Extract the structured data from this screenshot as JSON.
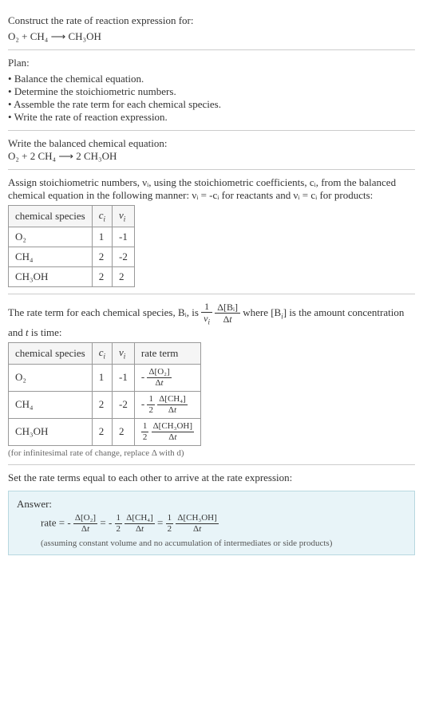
{
  "header": {
    "prompt": "Construct the rate of reaction expression for:",
    "unbalanced": "O₂ + CH₄  ⟶  CH₃OH"
  },
  "plan": {
    "label": "Plan:",
    "items": [
      "Balance the chemical equation.",
      "Determine the stoichiometric numbers.",
      "Assemble the rate term for each chemical species.",
      "Write the rate of reaction expression."
    ]
  },
  "balanced": {
    "label": "Write the balanced chemical equation:",
    "eq": "O₂ + 2 CH₄  ⟶  2 CH₃OH"
  },
  "stoich_intro": "Assign stoichiometric numbers, νᵢ, using the stoichiometric coefficients, cᵢ, from the balanced chemical equation in the following manner: νᵢ = -cᵢ for reactants and νᵢ = cᵢ for products:",
  "stoich_table": {
    "headers": [
      "chemical species",
      "cᵢ",
      "νᵢ"
    ],
    "rows": [
      {
        "species": "O₂",
        "c": "1",
        "v": "-1"
      },
      {
        "species": "CH₄",
        "c": "2",
        "v": "-2"
      },
      {
        "species": "CH₃OH",
        "c": "2",
        "v": "2"
      }
    ]
  },
  "rate_intro_pre": "The rate term for each chemical species, Bᵢ, is ",
  "rate_intro_frac_top1": "1",
  "rate_intro_frac_bot1": "νᵢ",
  "rate_intro_frac_top2": "Δ[Bᵢ]",
  "rate_intro_frac_bot2": "Δt",
  "rate_intro_post": " where [Bᵢ] is the amount concentration and t is time:",
  "rate_table": {
    "headers": [
      "chemical species",
      "cᵢ",
      "νᵢ",
      "rate term"
    ],
    "rows": [
      {
        "species": "O₂",
        "c": "1",
        "v": "-1",
        "coef": "",
        "neg": "-",
        "top": "Δ[O₂]",
        "bot": "Δt"
      },
      {
        "species": "CH₄",
        "c": "2",
        "v": "-2",
        "coef": "½",
        "neg": "-",
        "top": "Δ[CH₄]",
        "bot": "Δt",
        "coefTop": "1",
        "coefBot": "2"
      },
      {
        "species": "CH₃OH",
        "c": "2",
        "v": "2",
        "coef": "½",
        "neg": "",
        "top": "Δ[CH₃OH]",
        "bot": "Δt",
        "coefTop": "1",
        "coefBot": "2"
      }
    ]
  },
  "rate_footnote": "(for infinitesimal rate of change, replace Δ with d)",
  "final_label": "Set the rate terms equal to each other to arrive at the rate expression:",
  "answer": {
    "label": "Answer:",
    "prefix": "rate = ",
    "t1": {
      "neg": "-",
      "top": "Δ[O₂]",
      "bot": "Δt"
    },
    "eq1": " = ",
    "t2": {
      "neg": "-",
      "coefTop": "1",
      "coefBot": "2",
      "top": "Δ[CH₄]",
      "bot": "Δt"
    },
    "eq2": " = ",
    "t3": {
      "neg": "",
      "coefTop": "1",
      "coefBot": "2",
      "top": "Δ[CH₃OH]",
      "bot": "Δt"
    },
    "assume": "(assuming constant volume and no accumulation of intermediates or side products)"
  },
  "chart_data": {
    "type": "table",
    "title": "Stoichiometric numbers and rate terms for O₂ + 2CH₄ → 2CH₃OH",
    "species": [
      "O₂",
      "CH₄",
      "CH₃OH"
    ],
    "c_i": [
      1,
      2,
      2
    ],
    "nu_i": [
      -1,
      -2,
      2
    ],
    "rate_terms": [
      "-Δ[O₂]/Δt",
      "-(1/2)Δ[CH₄]/Δt",
      "(1/2)Δ[CH₃OH]/Δt"
    ],
    "rate_expression": "rate = -Δ[O₂]/Δt = -(1/2)Δ[CH₄]/Δt = (1/2)Δ[CH₃OH]/Δt"
  }
}
